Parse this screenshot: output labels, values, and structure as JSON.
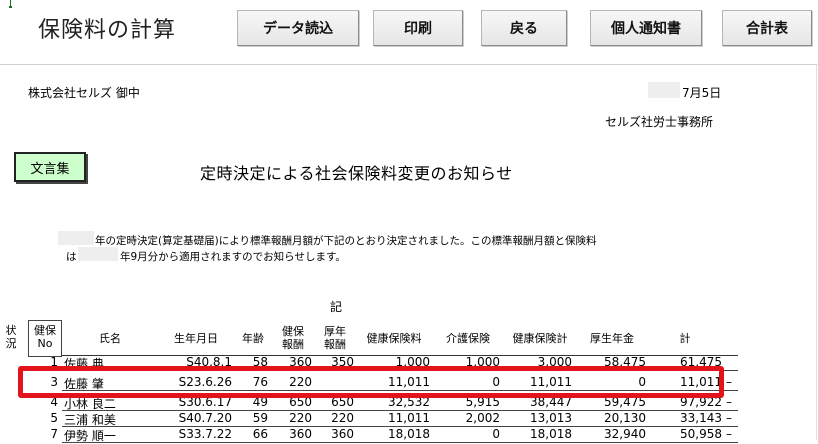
{
  "app": {
    "title": "保険料の計算"
  },
  "toolbar": {
    "buttons": [
      "データ読込",
      "印刷",
      "戻る",
      "個人通知書",
      "合計表"
    ]
  },
  "letter": {
    "recipient": "株式会社セルズ 御中",
    "date": "7月5日",
    "sender": "セルズ社労士事務所",
    "template_button": "文言集",
    "subject": "定時決定による社会保険料変更のお知らせ",
    "para_line1": "年の定時決定(算定基礎届)により標準報酬月額が下記のとおり決定されました。この標準報酬月額と保険料",
    "para_line2_a": "は",
    "para_line2_b": "年9月分から適用されますのでお知らせします。",
    "ki": "記"
  },
  "table": {
    "headers": {
      "status": "状況",
      "no": "健保No",
      "name": "氏名",
      "birth": "生年月日",
      "age": "年齢",
      "kenpo_hoshu": "健保報酬",
      "kosei_hoshu": "厚年報酬",
      "kenko_hokenryo": "健康保険料",
      "kaigo": "介護保険",
      "kenko_total": "健康保険計",
      "kosei_nenkin": "厚生年金",
      "total": "計"
    },
    "rows": [
      {
        "no": "1",
        "name": "佐藤 典",
        "birth": "S40.8.1",
        "age": "58",
        "kenpo": "360",
        "kosei": "350",
        "kenko": "1,000",
        "kaigo": "1,000",
        "kenko_total": "3,000",
        "nenkin": "58,475",
        "total": "61,475",
        "mark": ""
      },
      {
        "no": "3",
        "name": "佐藤 肇",
        "birth": "S23.6.26",
        "age": "76",
        "kenpo": "220",
        "kosei": "",
        "kenko": "11,011",
        "kaigo": "0",
        "kenko_total": "11,011",
        "nenkin": "0",
        "total": "11,011",
        "mark": "–"
      },
      {
        "no": "4",
        "name": "小林 良二",
        "birth": "S30.6.17",
        "age": "49",
        "kenpo": "650",
        "kosei": "650",
        "kenko": "32,532",
        "kaigo": "5,915",
        "kenko_total": "38,447",
        "nenkin": "59,475",
        "total": "97,922",
        "mark": "–"
      },
      {
        "no": "5",
        "name": "三浦 和美",
        "birth": "S40.7.20",
        "age": "59",
        "kenpo": "220",
        "kosei": "220",
        "kenko": "11,011",
        "kaigo": "2,002",
        "kenko_total": "13,013",
        "nenkin": "20,130",
        "total": "33,143",
        "mark": "–"
      },
      {
        "no": "7",
        "name": "伊勢 順一",
        "birth": "S33.7.22",
        "age": "66",
        "kenpo": "360",
        "kosei": "360",
        "kenko": "18,018",
        "kaigo": "0",
        "kenko_total": "18,018",
        "nenkin": "32,940",
        "total": "50,958",
        "mark": "–"
      }
    ]
  }
}
